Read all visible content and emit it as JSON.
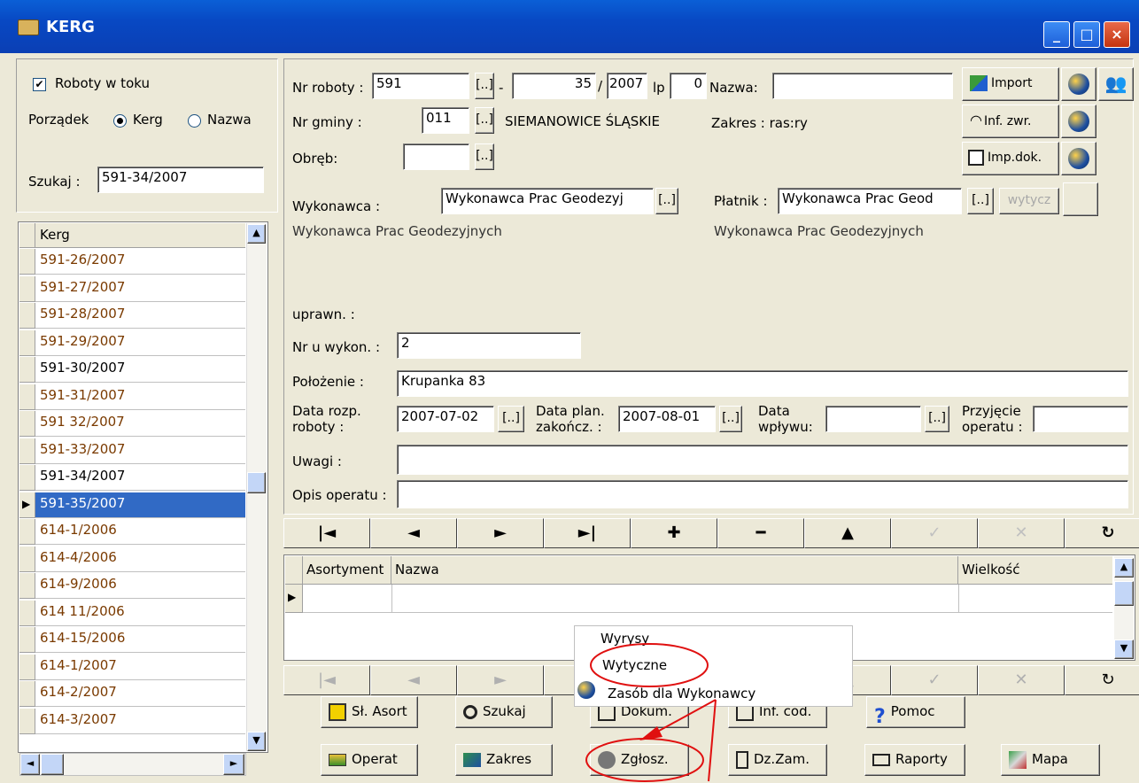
{
  "window": {
    "title": "KERG",
    "min": "_",
    "max": "□",
    "close": "×"
  },
  "left": {
    "checkbox_label": "Roboty w toku",
    "porzadek_label": "Porządek",
    "radio_kerg": "Kerg",
    "radio_nazwa": "Nazwa",
    "search_label": "Szukaj :",
    "search_value": "591-34/2007",
    "list_header": "Kerg",
    "items": [
      "591-26/2007",
      "591-27/2007",
      "591-28/2007",
      "591-29/2007",
      "591-30/2007",
      "591-31/2007",
      "591 32/2007",
      "591-33/2007",
      "591-34/2007",
      "591-35/2007",
      "614-1/2006",
      "614-4/2006",
      "614-9/2006",
      "614 11/2006",
      "614-15/2006",
      "614-1/2007",
      "614-2/2007",
      "614-3/2007"
    ]
  },
  "form": {
    "nr_roboty_label": "Nr roboty :",
    "nr_roboty": "591",
    "dots": "[..]",
    "dash": "-",
    "nr2": "35",
    "slash": "/",
    "year": "2007",
    "lp_label": "lp",
    "lp": "0",
    "nazwa_label": "Nazwa:",
    "nazwa": "",
    "nr_gminy_label": "Nr gminy :",
    "nr_gminy": "011",
    "gmina_name": "SIEMANOWICE ŚLĄSKIE",
    "zakres": "Zakres : ras:ry",
    "obreb_label": "Obręb:",
    "obreb": "",
    "wykonawca_label": "Wykonawca :",
    "wykonawca": "Wykonawca Prac Geodezyj",
    "wykonawca_full": "Wykonawca Prac Geodezyjnych",
    "platnik_label": "Płatnik :",
    "platnik": "Wykonawca Prac Geod",
    "platnik_full": "Wykonawca Prac Geodezyjnych",
    "wytycz": "wytycz",
    "uprawn_label": "uprawn. :",
    "nr_u_wykon_label": "Nr u wykon. :",
    "nr_u_wykon": "2",
    "polozenie_label": "Położenie :",
    "polozenie": "Krupanka 83",
    "data_rozp_label1": "Data rozp.",
    "data_rozp_label2": "roboty :",
    "data_rozp": "2007-07-02",
    "data_plan_label1": "Data plan.",
    "data_plan_label2": "zakończ. :",
    "data_plan": "2007-08-01",
    "data_wplywu_label1": "Data",
    "data_wplywu_label2": "wpływu:",
    "przyjecie_label1": "Przyjęcie",
    "przyjecie_label2": "operatu :",
    "uwagi_label": "Uwagi :",
    "opis_label": "Opis operatu :"
  },
  "side_buttons": {
    "import": "Import",
    "inf_zwr": "Inf. zwr.",
    "imp_dok": "Imp.dok."
  },
  "grid": {
    "col1": "Asortyment",
    "col2": "Nazwa",
    "col3": "Wielkość"
  },
  "nav": [
    "|◄",
    "◄",
    "►",
    "►|",
    "✚",
    "━",
    "▲",
    "✓",
    "✕",
    "↻"
  ],
  "popup": {
    "item1": "Wyrysy",
    "item2": "Wytyczne",
    "item3": "Zasób dla Wykonawcy"
  },
  "buttons_row1": {
    "slasort": "Sł. Asort",
    "szukaj": "Szukaj",
    "dokum": "Dokum.",
    "infcod": "Inf. cod.",
    "pomoc": "Pomoc"
  },
  "buttons_row2": {
    "operat": "Operat",
    "zakres": "Zakres",
    "zglosz": "Zgłosz.",
    "dzzam": "Dz.Zam.",
    "raporty": "Raporty",
    "mapa": "Mapa"
  }
}
